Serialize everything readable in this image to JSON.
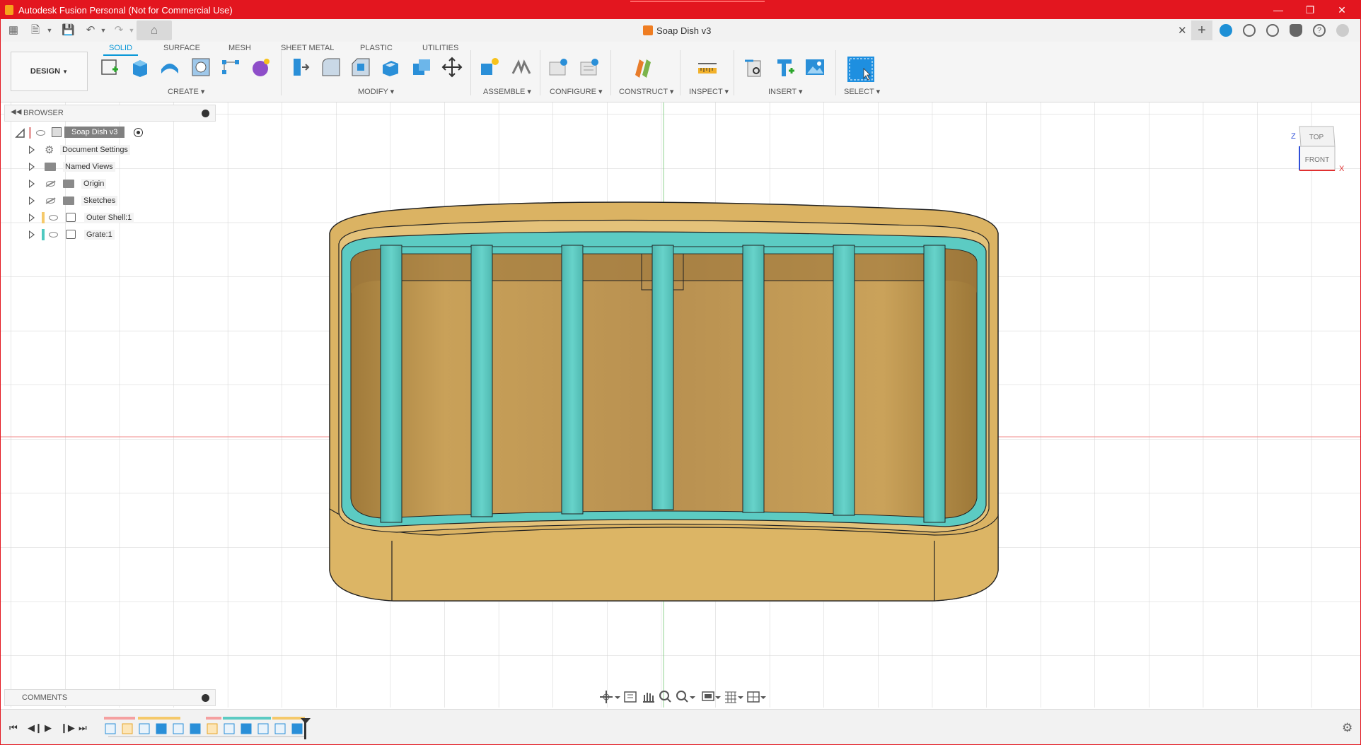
{
  "window": {
    "title": "Autodesk Fusion Personal (Not for Commercial Use)"
  },
  "document_tab": {
    "name": "Soap Dish v3"
  },
  "workspace": {
    "label": "DESIGN"
  },
  "ribbon_tabs": [
    "SOLID",
    "SURFACE",
    "MESH",
    "SHEET METAL",
    "PLASTIC",
    "UTILITIES"
  ],
  "active_tab": "SOLID",
  "tool_groups": [
    "CREATE",
    "MODIFY",
    "ASSEMBLE",
    "CONFIGURE",
    "CONSTRUCT",
    "INSPECT",
    "INSERT",
    "SELECT"
  ],
  "browser": {
    "title": "BROWSER",
    "root": "Soap Dish v3",
    "items": [
      {
        "label": "Document Settings",
        "icon": "gear-icon"
      },
      {
        "label": "Named Views",
        "icon": "folder-icon"
      },
      {
        "label": "Origin",
        "icon": "folder-icon",
        "hidden": true
      },
      {
        "label": "Sketches",
        "icon": "folder-icon",
        "hidden": true
      },
      {
        "label": "Outer Shell:1",
        "icon": "component-icon",
        "color": "#f5c96a"
      },
      {
        "label": "Grate:1",
        "icon": "component-icon",
        "color": "#4fc9c0"
      }
    ]
  },
  "comments": {
    "title": "COMMENTS"
  },
  "viewcube": {
    "top": "TOP",
    "front": "FRONT",
    "axis_z": "Z",
    "axis_x": "X"
  },
  "colors": {
    "title_bar": "#e3161f",
    "accent": "#0696d7",
    "body_outer": "#dbb363",
    "body_grate": "#5ccbc3"
  }
}
